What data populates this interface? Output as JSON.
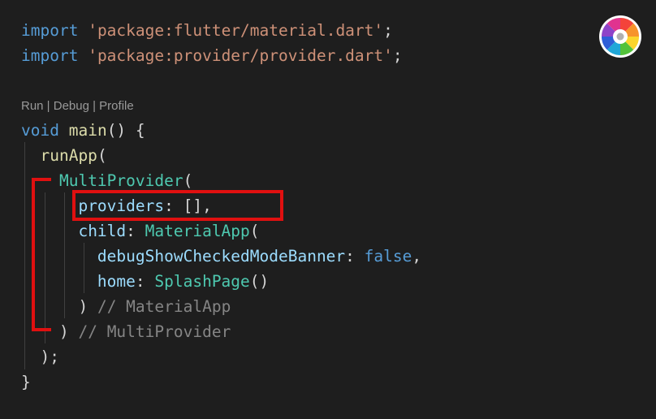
{
  "code": {
    "import1": {
      "keyword": "import",
      "path": "'package:flutter/material.dart'",
      "semi": ";"
    },
    "import2": {
      "keyword": "import",
      "path": "'package:provider/provider.dart'",
      "semi": ";"
    },
    "codelens": "Run | Debug | Profile",
    "main_decl": {
      "type": "void",
      "name": "main",
      "rest": "() {"
    },
    "run_app": {
      "name": "runApp",
      "paren": "("
    },
    "multi_provider": {
      "name": "MultiProvider",
      "paren": "("
    },
    "providers": {
      "name": "providers",
      "rest": ": [],"
    },
    "child": {
      "name": "child",
      "colon": ": ",
      "value": "MaterialApp",
      "paren": "("
    },
    "debug_banner": {
      "name": "debugShowCheckedModeBanner",
      "colon": ": ",
      "value": "false",
      "comma": ","
    },
    "home": {
      "name": "home",
      "colon": ": ",
      "value": "SplashPage",
      "paren": "()"
    },
    "close_material": {
      "paren": ")",
      "comment": "// MaterialApp"
    },
    "close_multi": {
      "paren": ")",
      "comment": "// MultiProvider"
    },
    "close_runapp": ");",
    "close_main": "}"
  },
  "colors": {
    "background": "#1e1e1e",
    "keyword": "#569cd6",
    "string": "#ce9178",
    "function": "#dcdcaa",
    "class": "#4ec9b0",
    "property": "#9cdcfe",
    "comment": "#858585",
    "annotation": "#e01010"
  },
  "icons": {
    "logo": "color-wheel-icon"
  }
}
